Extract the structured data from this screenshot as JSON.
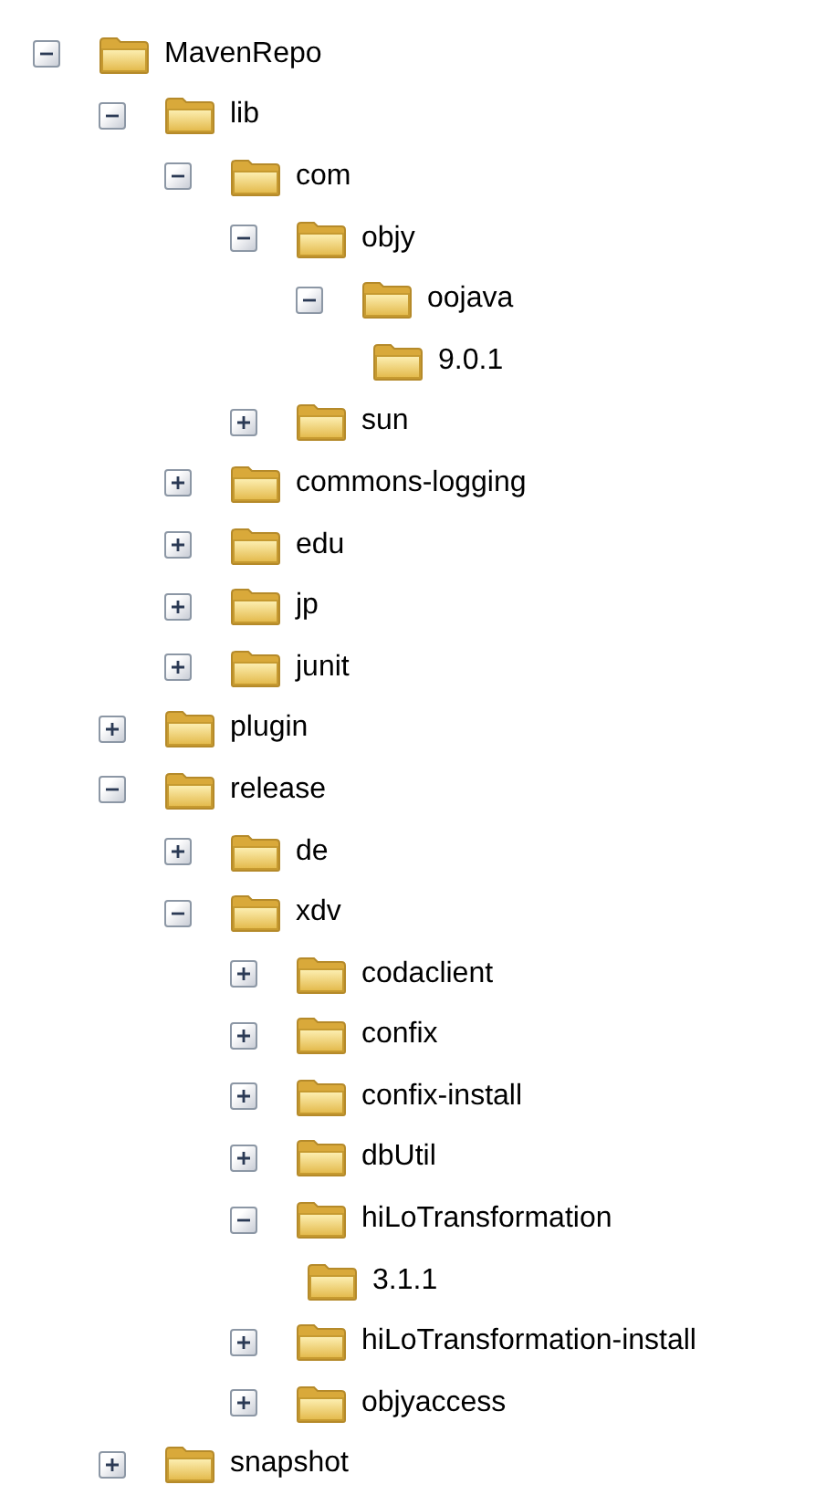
{
  "tree": [
    {
      "label": "MavenRepo",
      "expanded": true,
      "children": [
        {
          "label": "lib",
          "expanded": true,
          "children": [
            {
              "label": "com",
              "expanded": true,
              "children": [
                {
                  "label": "objy",
                  "expanded": true,
                  "children": [
                    {
                      "label": "oojava",
                      "expanded": true,
                      "children": [
                        {
                          "label": "9.0.1"
                        }
                      ]
                    }
                  ]
                },
                {
                  "label": "sun",
                  "expanded": false
                }
              ]
            },
            {
              "label": "commons-logging",
              "expanded": false
            },
            {
              "label": "edu",
              "expanded": false
            },
            {
              "label": "jp",
              "expanded": false
            },
            {
              "label": "junit",
              "expanded": false
            }
          ]
        },
        {
          "label": "plugin",
          "expanded": false
        },
        {
          "label": "release",
          "expanded": true,
          "children": [
            {
              "label": "de",
              "expanded": false
            },
            {
              "label": "xdv",
              "expanded": true,
              "children": [
                {
                  "label": "codaclient",
                  "expanded": false
                },
                {
                  "label": "confix",
                  "expanded": false
                },
                {
                  "label": "confix-install",
                  "expanded": false
                },
                {
                  "label": "dbUtil",
                  "expanded": false
                },
                {
                  "label": "hiLoTransformation",
                  "expanded": true,
                  "children": [
                    {
                      "label": "3.1.1"
                    }
                  ]
                },
                {
                  "label": "hiLoTransformation-install",
                  "expanded": false
                },
                {
                  "label": "objyaccess",
                  "expanded": false
                }
              ]
            }
          ]
        },
        {
          "label": "snapshot",
          "expanded": false
        }
      ]
    }
  ]
}
